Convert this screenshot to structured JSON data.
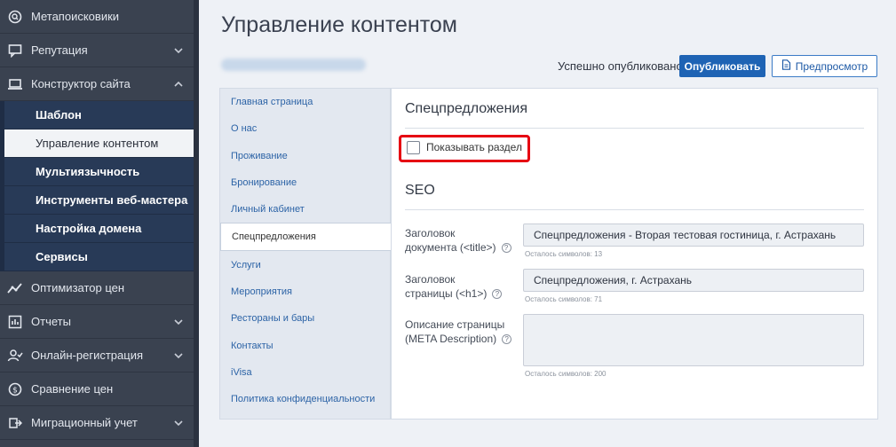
{
  "sidebar": {
    "items": [
      {
        "label": "Метапоисковики",
        "icon": "metasearch-icon",
        "chevron": false
      },
      {
        "label": "Репутация",
        "icon": "chat-icon",
        "chevron": "down"
      },
      {
        "label": "Конструктор сайта",
        "icon": "laptop-icon",
        "chevron": "up"
      }
    ],
    "sub_items": [
      {
        "label": "Шаблон",
        "active": false
      },
      {
        "label": "Управление контентом",
        "active": true
      },
      {
        "label": "Мультиязычность",
        "active": false
      },
      {
        "label": "Инструменты веб-мастера",
        "active": false
      },
      {
        "label": "Настройка домена",
        "active": false
      },
      {
        "label": "Сервисы",
        "active": false
      }
    ],
    "items_after": [
      {
        "label": "Оптимизатор цен",
        "icon": "trend-icon",
        "chevron": false
      },
      {
        "label": "Отчеты",
        "icon": "report-icon",
        "chevron": "down"
      },
      {
        "label": "Онлайн-регистрация",
        "icon": "user-check-icon",
        "chevron": "down"
      },
      {
        "label": "Сравнение цен",
        "icon": "price-compare-icon",
        "chevron": false
      },
      {
        "label": "Миграционный учет",
        "icon": "migration-icon",
        "chevron": "down"
      }
    ]
  },
  "header": {
    "title": "Управление контентом",
    "status": "Успешно опубликовано",
    "publish_label": "Опубликовать",
    "preview_label": "Предпросмотр"
  },
  "content_nav": {
    "items": [
      {
        "label": "Главная страница",
        "active": false
      },
      {
        "label": "О нас",
        "active": false
      },
      {
        "label": "Проживание",
        "active": false
      },
      {
        "label": "Бронирование",
        "active": false
      },
      {
        "label": "Личный кабинет",
        "active": false
      },
      {
        "label": "Спецпредложения",
        "active": true
      },
      {
        "label": "Услуги",
        "active": false
      },
      {
        "label": "Мероприятия",
        "active": false
      },
      {
        "label": "Рестораны и бары",
        "active": false
      },
      {
        "label": "Контакты",
        "active": false
      },
      {
        "label": "iVisa",
        "active": false
      },
      {
        "label": "Политика конфиденциальности",
        "active": false
      }
    ]
  },
  "section": {
    "title": "Спецпредложения",
    "show_section_label": "Показывать раздел",
    "show_section_checked": false,
    "seo_title": "SEO",
    "fields": [
      {
        "label_line1": "Заголовок",
        "label_line2": "документа (<title>)",
        "value": "Спецпредложения - Вторая тестовая гостиница, г. Астрахань",
        "counter": "Осталось символов: 13"
      },
      {
        "label_line1": "Заголовок",
        "label_line2": "страницы (<h1>)",
        "value": "Спецпредложения, г. Астрахань",
        "counter": "Осталось символов: 71"
      },
      {
        "label_line1": "Описание страницы",
        "label_line2": "(META Description)",
        "value": "",
        "counter": "Осталось символов: 200"
      }
    ]
  },
  "colors": {
    "sidebar_bg": "#3a4250",
    "sub_bg": "#283a57",
    "primary": "#1e63b4",
    "highlight": "#e60012"
  }
}
